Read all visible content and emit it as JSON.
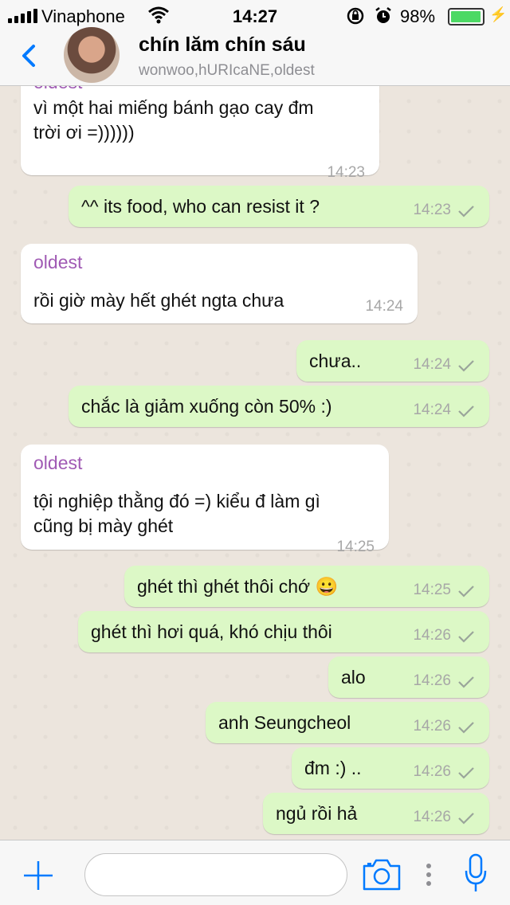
{
  "status": {
    "carrier": "Vinaphone",
    "time": "14:27",
    "battery_pct": "98%",
    "battery_level": 0.98,
    "icons": [
      "signal-icon",
      "wifi-icon",
      "rotation-lock-icon",
      "alarm-icon",
      "battery-icon",
      "charging-icon"
    ]
  },
  "header": {
    "title": "chín lăm chín sáu",
    "subtitle": "wonwoo,hURIcaNE,oldest"
  },
  "messages": [
    {
      "dir": "in",
      "sender": "oldest",
      "text": "vì một hai miếng bánh gạo cay đm\ntrời ơi =))))))",
      "time": "14:23"
    },
    {
      "dir": "out",
      "text": "^^ its food, who can resist it ?",
      "time": "14:23"
    },
    {
      "dir": "in",
      "sender": "oldest",
      "text": "rồi giờ mày hết ghét ngta chưa",
      "time": "14:24"
    },
    {
      "dir": "out",
      "text": "chưa..",
      "time": "14:24"
    },
    {
      "dir": "out",
      "text": "chắc là giảm xuống còn 50% :)",
      "time": "14:24"
    },
    {
      "dir": "in",
      "sender": "oldest",
      "text": "tội nghiệp thằng đó =) kiểu đ làm gì\ncũng bị mày ghét",
      "time": "14:25"
    },
    {
      "dir": "out",
      "text": "ghét thì ghét thôi chớ 😀",
      "time": "14:25"
    },
    {
      "dir": "out",
      "text": "ghét thì hơi quá, khó chịu thôi",
      "time": "14:26"
    },
    {
      "dir": "out",
      "text": "alo",
      "time": "14:26"
    },
    {
      "dir": "out",
      "text": "anh Seungcheol",
      "time": "14:26"
    },
    {
      "dir": "out",
      "text": "đm :) ..",
      "time": "14:26"
    },
    {
      "dir": "out",
      "text": "ngủ rồi hả",
      "time": "14:26"
    }
  ],
  "colors": {
    "accent": "#007aff",
    "sender_name": "#a05ab4",
    "outgoing_bubble": "#dcf8c6",
    "incoming_bubble": "#ffffff",
    "chat_background": "#ece5dd"
  },
  "input_bar": {
    "message_placeholder": "",
    "icons": [
      "plus-icon",
      "camera-icon",
      "more-icon",
      "microphone-icon"
    ]
  }
}
